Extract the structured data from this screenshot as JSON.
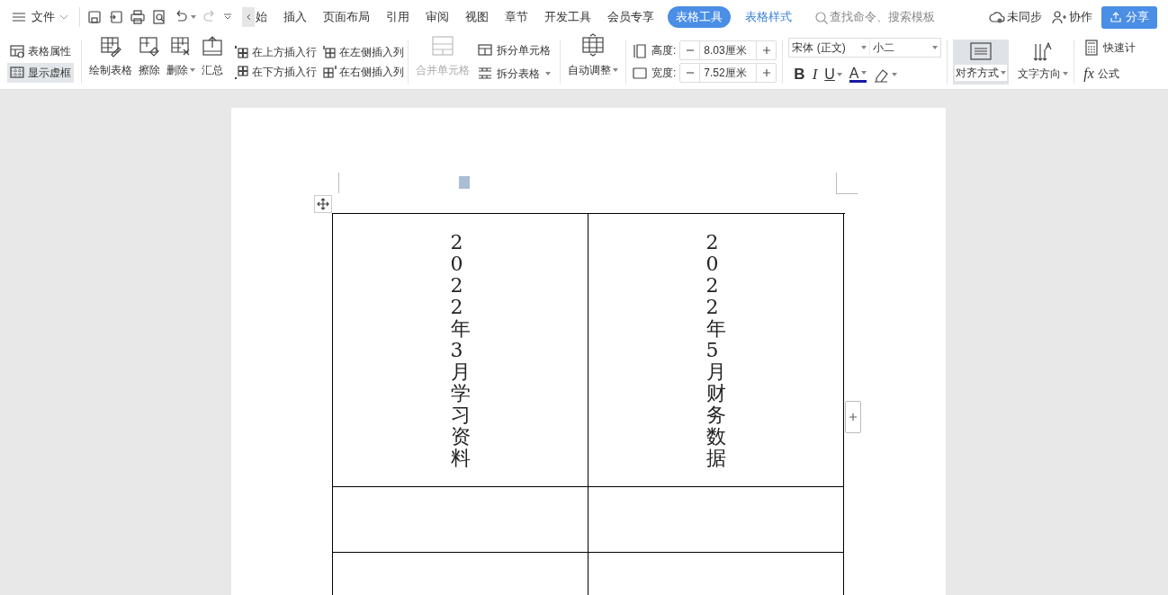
{
  "top_bar": {
    "menu": "文件",
    "tabs": [
      {
        "label": "始",
        "selected": false,
        "kind": "normal"
      },
      {
        "label": "插入",
        "selected": false,
        "kind": "normal"
      },
      {
        "label": "页面布局",
        "selected": false,
        "kind": "normal"
      },
      {
        "label": "引用",
        "selected": false,
        "kind": "normal"
      },
      {
        "label": "审阅",
        "selected": false,
        "kind": "normal"
      },
      {
        "label": "视图",
        "selected": false,
        "kind": "normal"
      },
      {
        "label": "章节",
        "selected": false,
        "kind": "normal"
      },
      {
        "label": "开发工具",
        "selected": false,
        "kind": "normal"
      },
      {
        "label": "会员专享",
        "selected": false,
        "kind": "normal"
      },
      {
        "label": "表格工具",
        "selected": true,
        "kind": "normal"
      },
      {
        "label": "表格样式",
        "selected": false,
        "kind": "contextual"
      }
    ],
    "search": {
      "placeholder": "查找命令、搜索模板"
    },
    "sync": "未同步",
    "collab": "协作",
    "share": "分享"
  },
  "ribbon": {
    "view_toggles": [
      {
        "label": "表格属性",
        "selected": false
      },
      {
        "label": "显示虚框",
        "selected": true
      }
    ],
    "draw_tools": [
      {
        "label": "绘制表格",
        "dropdown": false
      },
      {
        "label": "擦除",
        "dropdown": false
      },
      {
        "label": "删除",
        "dropdown": true
      },
      {
        "label": "汇总",
        "dropdown": false
      }
    ],
    "insert_buttons": [
      "在上方插入行",
      "在左侧插入列",
      "在下方插入行",
      "在右侧插入列"
    ],
    "merge": {
      "label": "合并单元格",
      "disabled": true
    },
    "split_buttons": [
      {
        "label": "拆分单元格",
        "dropdown": false
      },
      {
        "label": "拆分表格",
        "dropdown": true
      }
    ],
    "autofit": "自动调整",
    "size_fields": [
      {
        "label": "高度:",
        "value": "8.03厘米"
      },
      {
        "label": "宽度:",
        "value": "7.52厘米"
      }
    ],
    "font": {
      "family": "宋体 (正文)",
      "size": "小二"
    },
    "format_buttons": [
      {
        "glyph": "B",
        "kind": "bold"
      },
      {
        "glyph": "I",
        "kind": "italic"
      },
      {
        "glyph": "U",
        "kind": "underline"
      },
      {
        "glyph": "A",
        "kind": "color"
      }
    ],
    "align": {
      "label": "对齐方式",
      "selected": true
    },
    "direction": "文字方向",
    "quick_calc": "快速计",
    "formula_glyph": "fx",
    "formula": "公式"
  },
  "document": {
    "table": {
      "rows": [
        {
          "cells": [
            "2022年3月学习资料",
            "2022年5月财务数据"
          ]
        }
      ]
    }
  }
}
